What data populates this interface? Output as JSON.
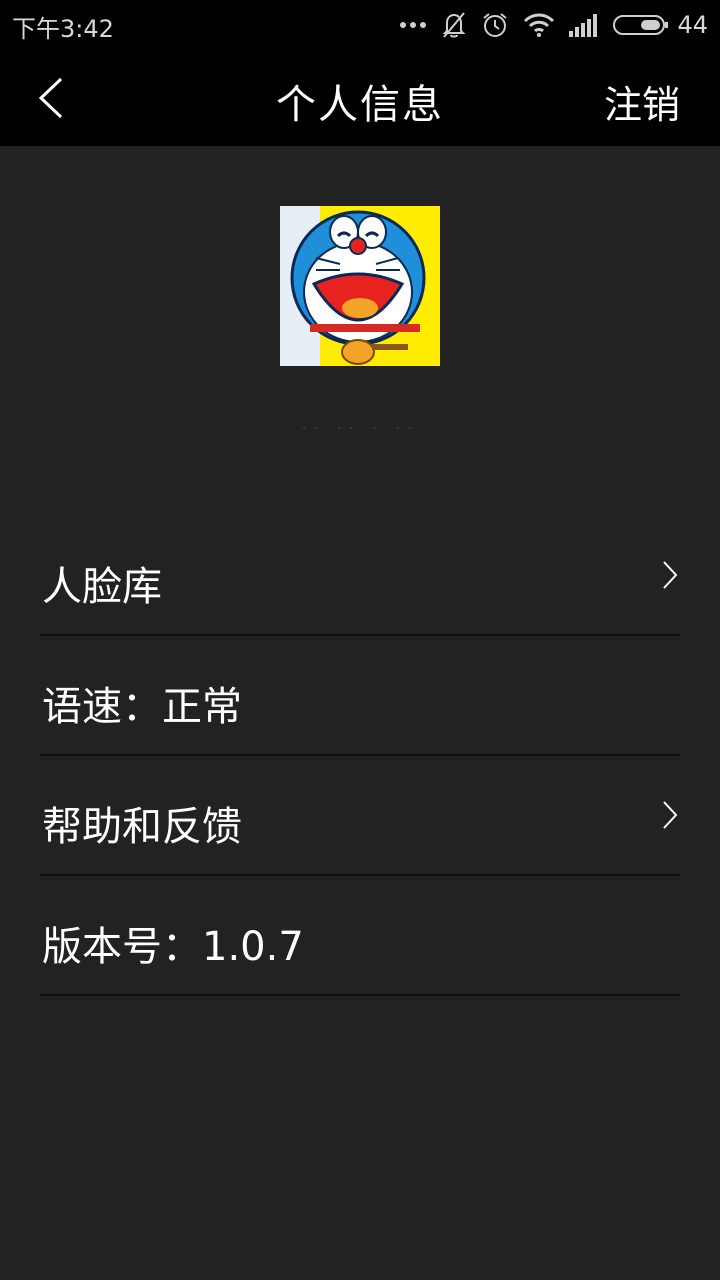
{
  "status_bar": {
    "time": "下午3:42",
    "battery": "44",
    "icons": [
      "more-dots-icon",
      "bell-muted-icon",
      "alarm-icon",
      "wifi-icon",
      "signal-icon",
      "battery-icon"
    ]
  },
  "header": {
    "title": "个人信息",
    "logout_label": "注销",
    "back_icon": "chevron-left-icon"
  },
  "profile": {
    "avatar_description": "cartoon avatar",
    "username": "·· ·· · ··"
  },
  "menu": {
    "items": [
      {
        "label": "人脸库",
        "has_chevron": true
      },
      {
        "label": "语速：正常",
        "has_chevron": false
      },
      {
        "label": "帮助和反馈",
        "has_chevron": true
      },
      {
        "label": "版本号：1.0.7",
        "has_chevron": false
      }
    ]
  },
  "colors": {
    "background": "#222222",
    "bar": "#000000",
    "text": "#ffffff",
    "divider": "#0e0e0e",
    "avatar_bg": "#ffec00"
  }
}
